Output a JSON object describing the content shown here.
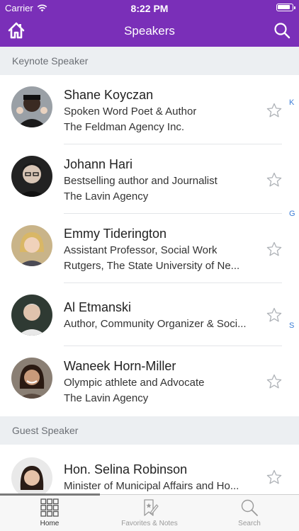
{
  "status_bar": {
    "carrier": "Carrier",
    "time": "8:22 PM"
  },
  "nav": {
    "title": "Speakers",
    "home_icon": "home-icon",
    "search_icon": "search-icon"
  },
  "sections": [
    {
      "title": "Keynote Speaker"
    },
    {
      "title": "Guest Speaker"
    }
  ],
  "speakers": [
    {
      "name": "Shane Koyczan",
      "line1": "Spoken Word Poet & Author",
      "line2": "The Feldman Agency Inc."
    },
    {
      "name": "Johann Hari",
      "line1": "Bestselling author and Journalist",
      "line2": "The Lavin Agency"
    },
    {
      "name": "Emmy Tiderington",
      "line1": "Assistant Professor, Social Work",
      "line2": "Rutgers, The State University of Ne..."
    },
    {
      "name": "Al Etmanski",
      "line1": "Author, Community Organizer & Soci...",
      "line2": ""
    },
    {
      "name": "Waneek Horn-Miller",
      "line1": "Olympic athlete and Advocate",
      "line2": "The Lavin Agency"
    },
    {
      "name": "Hon. Selina Robinson",
      "line1": "Minister of Municipal Affairs and Ho...",
      "line2": ""
    }
  ],
  "index_letters": [
    "K",
    "G",
    "S"
  ],
  "tabs": [
    {
      "label": "Home",
      "icon": "grid-icon",
      "active": true
    },
    {
      "label": "Favorites & Notes",
      "icon": "bookmark-note-icon",
      "active": false
    },
    {
      "label": "Search",
      "icon": "search-icon",
      "active": false
    }
  ],
  "colors": {
    "brand": "#7a2fb8",
    "section_bg": "#eceff2",
    "index": "#3a7bd5"
  }
}
